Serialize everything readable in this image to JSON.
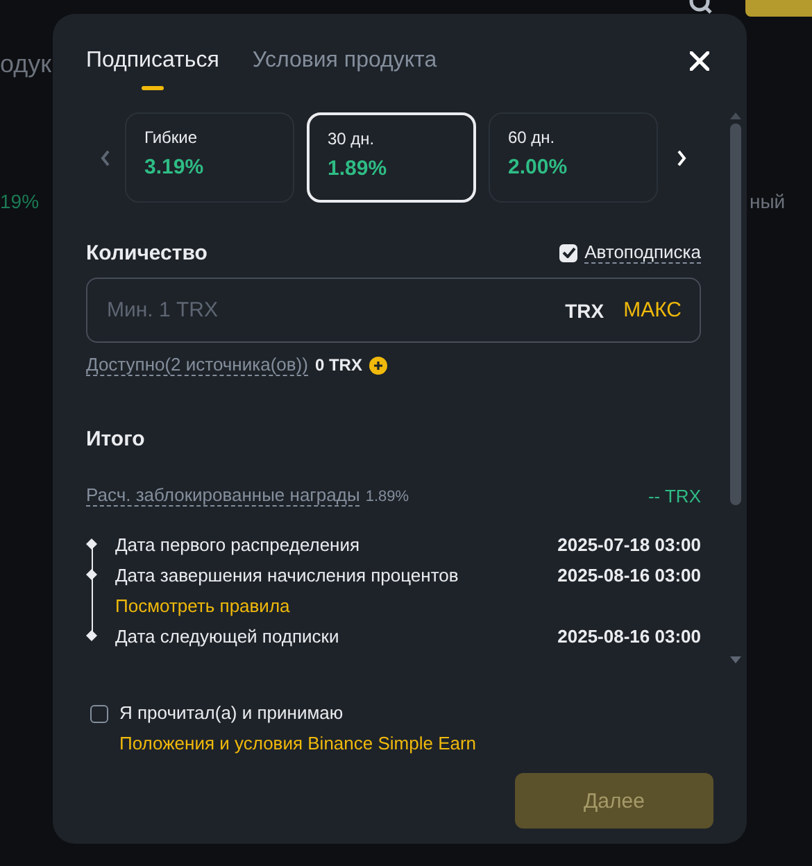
{
  "backdrop": {
    "texts": [
      {
        "text": "одук",
        "kind": "heading"
      },
      {
        "text": "19%",
        "kind": "rate"
      },
      {
        "text": "ный",
        "kind": "label"
      }
    ]
  },
  "tabs": [
    {
      "label": "Подписаться",
      "selected": true
    },
    {
      "label": "Условия продукта",
      "selected": false
    }
  ],
  "periods": [
    {
      "label": "Гибкие",
      "rate": "3.19%",
      "selected": false
    },
    {
      "label": "30 дн.",
      "rate": "1.89%",
      "selected": true
    },
    {
      "label": "60 дн.",
      "rate": "2.00%",
      "selected": false
    }
  ],
  "amount": {
    "label": "Количество",
    "auto_subscribe": {
      "label": "Автоподписка",
      "checked": true
    },
    "placeholder": "Мин. 1 TRX",
    "currency": "TRX",
    "max": "МАКС",
    "available_label": "Доступно(2 источника(ов))",
    "available_value": "0 TRX"
  },
  "summary": {
    "title": "Итого",
    "rewards_label": "Расч. заблокированные награды",
    "rewards_rate": "1.89%",
    "rewards_value": "-- TRX",
    "timeline": [
      {
        "label": "Дата первого распределения",
        "value": "2025-07-18 03:00"
      },
      {
        "label": "Дата завершения начисления процентов",
        "value": "2025-08-16 03:00",
        "link": "Посмотреть правила"
      },
      {
        "label": "Дата следующей подписки",
        "value": "2025-08-16 03:00"
      }
    ]
  },
  "agreement": {
    "checked": false,
    "text": "Я прочитал(а) и принимаю ",
    "link": "Положения и условия Binance Simple Earn"
  },
  "next_button": {
    "label": "Далее",
    "disabled": true
  }
}
